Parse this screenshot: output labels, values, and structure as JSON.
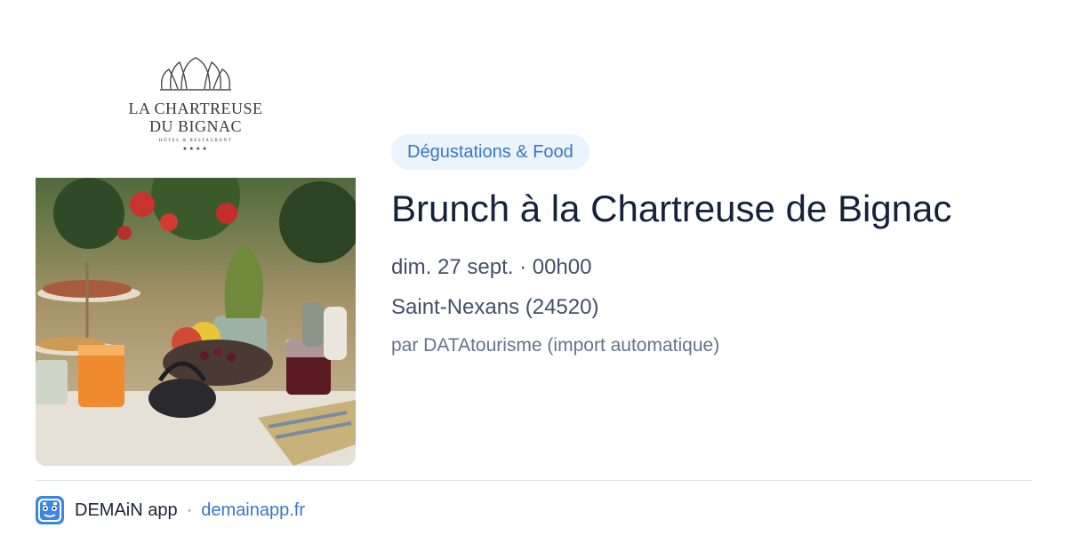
{
  "logo": {
    "line1": "LA CHARTREUSE",
    "line2": "DU BIGNAC",
    "line3": "HÔTEL & RESTAURANT",
    "stars": "★★★★"
  },
  "event": {
    "category": "Dégustations & Food",
    "title": "Brunch à la Chartreuse de Bignac",
    "date": "dim. 27 sept. · 00h00",
    "location": "Saint-Nexans (24520)",
    "source": "par DATAtourisme (import automatique)"
  },
  "footer": {
    "app_name": "DEMAiN app",
    "separator": "·",
    "link": "demainapp.fr"
  },
  "colors": {
    "accent": "#3a76c9",
    "pill_bg": "#ebf3fc",
    "title": "#16213a",
    "meta": "#445066"
  },
  "icons": {
    "app": "demain-app-icon",
    "logo": "shell-logo-icon"
  }
}
